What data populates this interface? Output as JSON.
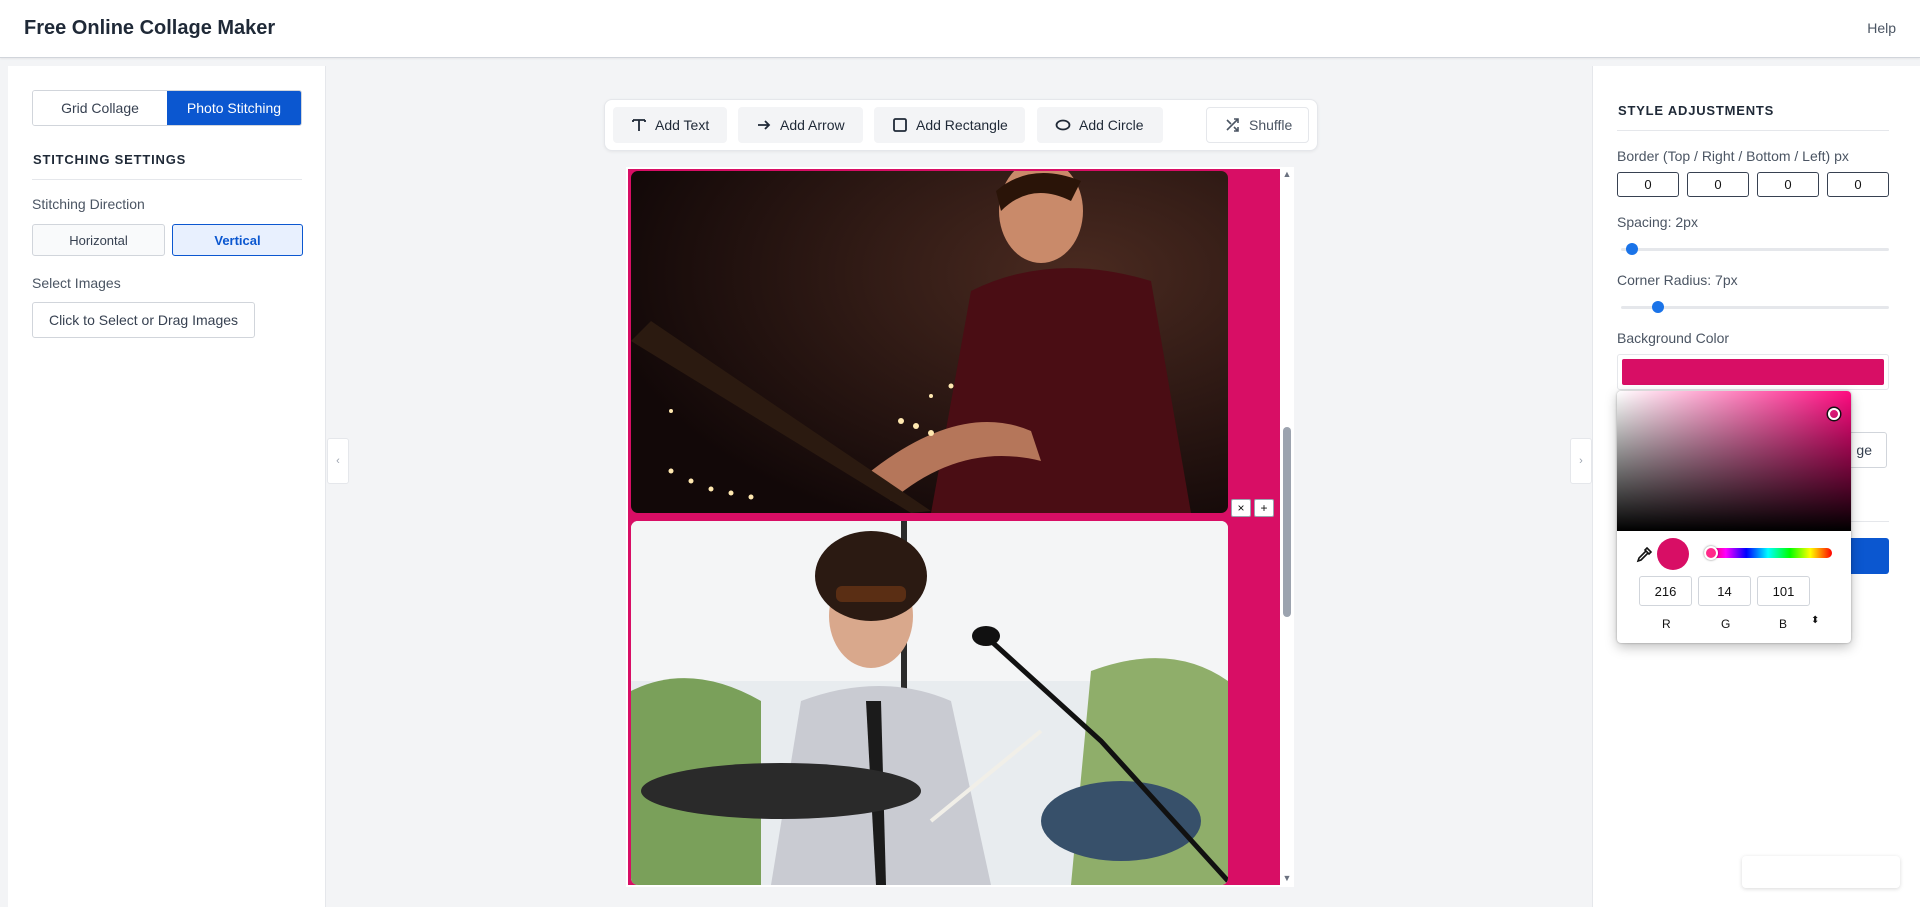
{
  "header": {
    "title": "Free Online Collage Maker",
    "help": "Help"
  },
  "left_panel": {
    "tabs": [
      "Grid Collage",
      "Photo Stitching"
    ],
    "active_tab": "Photo Stitching",
    "section_title": "STITCHING SETTINGS",
    "direction_label": "Stitching Direction",
    "direction_options": [
      "Horizontal",
      "Vertical"
    ],
    "direction_selected": "Vertical",
    "select_images_label": "Select Images",
    "select_images_button": "Click to Select or Drag Images"
  },
  "toolbar": {
    "add_text": "Add Text",
    "add_arrow": "Add Arrow",
    "add_rectangle": "Add Rectangle",
    "add_circle": "Add Circle",
    "shuffle": "Shuffle"
  },
  "canvas": {
    "background_color": "#d80e65",
    "remove_button": "×",
    "add_button": "+"
  },
  "right_panel": {
    "title": "STYLE ADJUSTMENTS",
    "border_label": "Border (Top / Right / Bottom / Left) px",
    "border_values": [
      "0",
      "0",
      "0",
      "0"
    ],
    "spacing_label": "Spacing: 2px",
    "spacing_value": 2,
    "corner_radius_label": "Corner Radius: 7px",
    "corner_radius_value": 7,
    "background_color_label": "Background Color",
    "background_color": "#d80e65",
    "partially_hidden_button_text": "ge"
  },
  "color_picker": {
    "r": "216",
    "g": "14",
    "b": "101",
    "labels": [
      "R",
      "G",
      "B"
    ],
    "toggle_glyph": "⬍",
    "color": "#d80e65"
  },
  "colors": {
    "accent": "#0b57d0",
    "brand_pink": "#d80e65"
  },
  "icons": {
    "add_text": "text-icon",
    "add_arrow": "arrow-right-icon",
    "add_rectangle": "square-icon",
    "add_circle": "ellipse-icon",
    "shuffle": "shuffle-icon",
    "eyedropper": "eyedropper-icon"
  }
}
